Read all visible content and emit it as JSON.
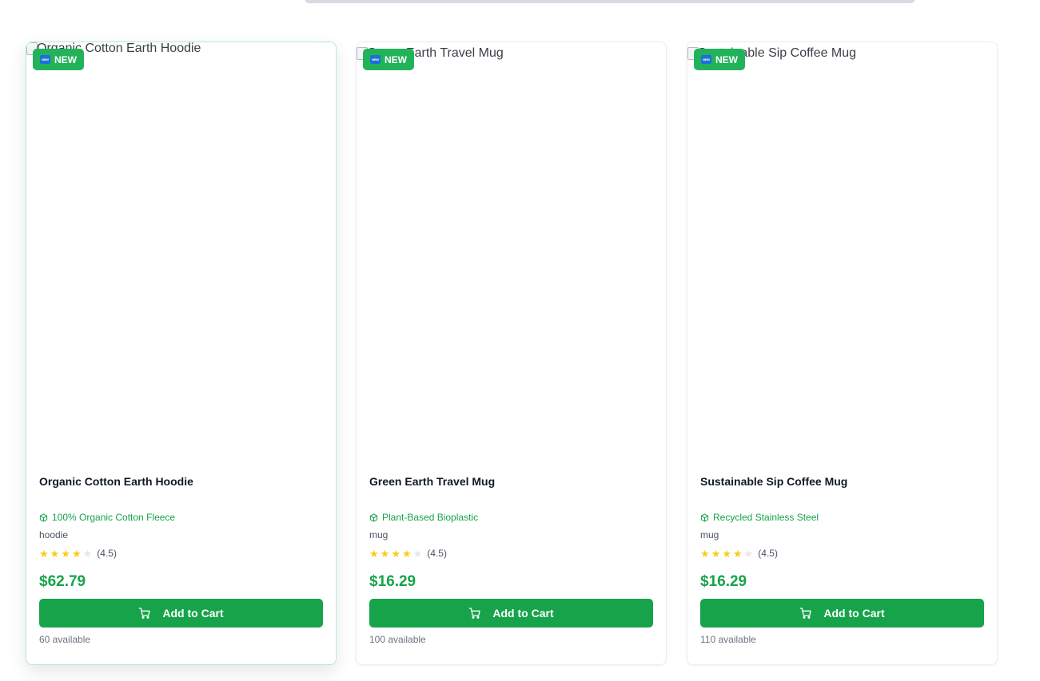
{
  "products": [
    {
      "alt": "Organic Cotton Earth Hoodie",
      "badge": "NEW",
      "badge_icon": "NEW",
      "name": "Organic Cotton Earth Hoodie",
      "material": "100% Organic Cotton Fleece",
      "category": "hoodie",
      "rating": 4.5,
      "rating_text": "(4.5)",
      "price": "$62.79",
      "button": "Add to Cart",
      "stock": "60 available"
    },
    {
      "alt": "Green Earth Travel Mug",
      "badge": "NEW",
      "badge_icon": "NEW",
      "name": "Green Earth Travel Mug",
      "material": "Plant-Based Bioplastic",
      "category": "mug",
      "rating": 4.5,
      "rating_text": "(4.5)",
      "price": "$16.29",
      "button": "Add to Cart",
      "stock": "100 available"
    },
    {
      "alt": "Sustainable Sip Coffee Mug",
      "badge": "NEW",
      "badge_icon": "NEW",
      "name": "Sustainable Sip Coffee Mug",
      "material": "Recycled Stainless Steel",
      "category": "mug",
      "rating": 4.5,
      "rating_text": "(4.5)",
      "price": "$16.29",
      "button": "Add to Cart",
      "stock": "110 available"
    }
  ],
  "colors": {
    "accent": "#16a34a",
    "badge": "#22b35a",
    "star": "#facc15",
    "star_empty": "#e5e7eb"
  },
  "icons": {
    "material": "box-icon",
    "cart": "cart-icon",
    "rating": "star-icon"
  }
}
